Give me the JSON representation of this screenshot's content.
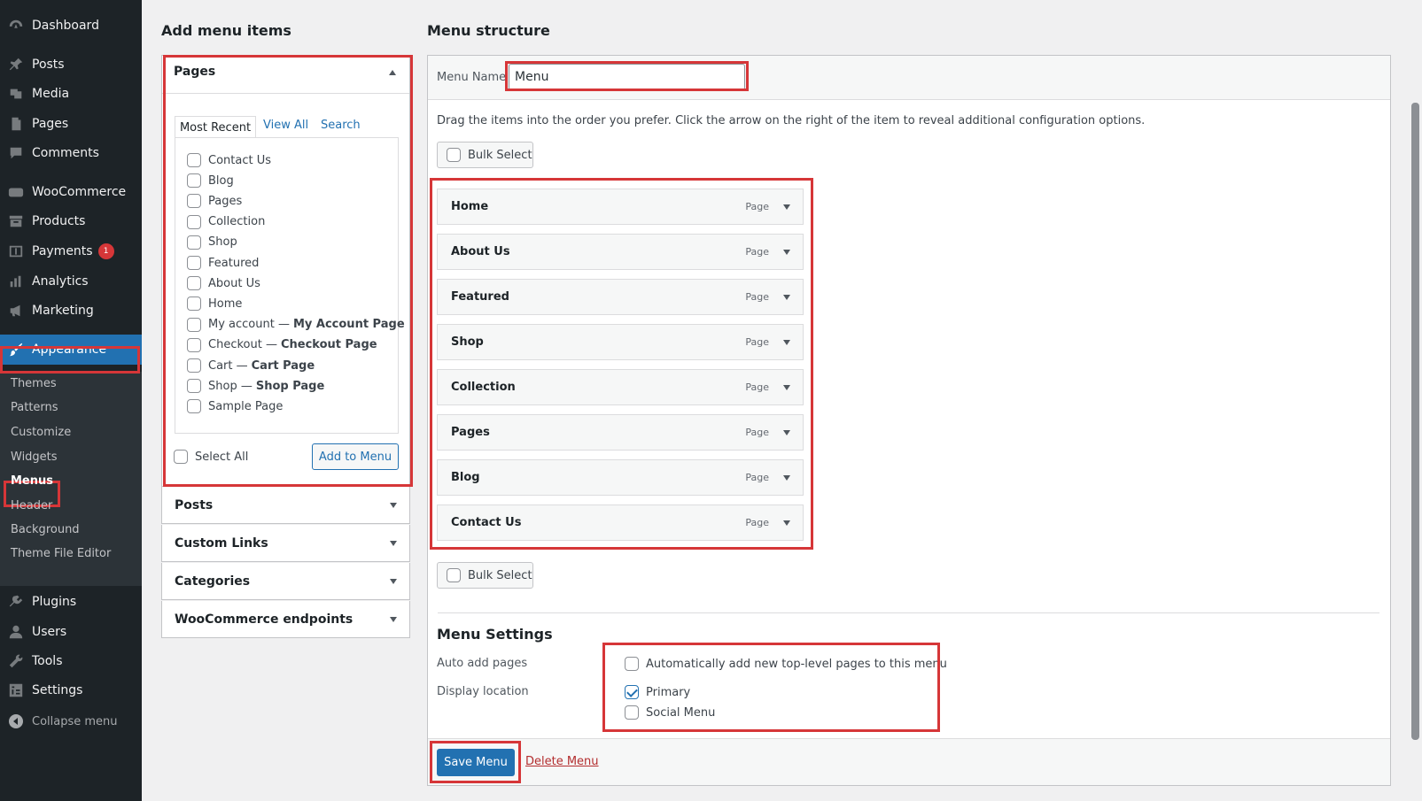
{
  "sidebar": {
    "top_items": [
      {
        "label": "Dashboard",
        "icon": "dashboard-icon"
      },
      {
        "label": "Posts",
        "icon": "pin-icon"
      },
      {
        "label": "Media",
        "icon": "media-icon"
      },
      {
        "label": "Pages",
        "icon": "pages-icon"
      },
      {
        "label": "Comments",
        "icon": "comment-icon"
      },
      {
        "label": "WooCommerce",
        "icon": "woo-icon"
      },
      {
        "label": "Products",
        "icon": "archive-icon"
      },
      {
        "label": "Payments",
        "icon": "payment-icon",
        "badge": "1"
      },
      {
        "label": "Analytics",
        "icon": "bar-chart-icon"
      },
      {
        "label": "Marketing",
        "icon": "megaphone-icon"
      },
      {
        "label": "Appearance",
        "icon": "brush-icon"
      }
    ],
    "submenu": [
      "Themes",
      "Patterns",
      "Customize",
      "Widgets",
      "Menus",
      "Header",
      "Background",
      "Theme File Editor"
    ],
    "bottom_items": [
      {
        "label": "Plugins",
        "icon": "plugin-icon"
      },
      {
        "label": "Users",
        "icon": "user-icon"
      },
      {
        "label": "Tools",
        "icon": "wrench-icon"
      },
      {
        "label": "Settings",
        "icon": "settings-icon"
      }
    ],
    "collapse_label": "Collapse menu"
  },
  "add_items": {
    "heading": "Add menu items",
    "pages_title": "Pages",
    "tabs": [
      "Most Recent",
      "View All",
      "Search"
    ],
    "pages": [
      {
        "label": "Contact Us"
      },
      {
        "label": "Blog"
      },
      {
        "label": "Pages"
      },
      {
        "label": "Collection"
      },
      {
        "label": "Shop"
      },
      {
        "label": "Featured"
      },
      {
        "label": "About Us"
      },
      {
        "label": "Home"
      },
      {
        "label": "My account —",
        "strong": "My Account Page"
      },
      {
        "label": "Checkout —",
        "strong": "Checkout Page"
      },
      {
        "label": "Cart —",
        "strong": "Cart Page"
      },
      {
        "label": "Shop —",
        "strong": "Shop Page"
      },
      {
        "label": "Sample Page"
      }
    ],
    "select_all": "Select All",
    "add_button": "Add to Menu",
    "other_sections": [
      "Posts",
      "Custom Links",
      "Categories",
      "WooCommerce endpoints"
    ]
  },
  "structure": {
    "heading": "Menu structure",
    "menu_name_label": "Menu Name",
    "menu_name_value": "Menu",
    "instructions": "Drag the items into the order you prefer. Click the arrow on the right of the item to reveal additional configuration options.",
    "bulk_select": "Bulk Select",
    "items": [
      {
        "title": "Home",
        "type": "Page"
      },
      {
        "title": "About Us",
        "type": "Page"
      },
      {
        "title": "Featured",
        "type": "Page"
      },
      {
        "title": "Shop",
        "type": "Page"
      },
      {
        "title": "Collection",
        "type": "Page"
      },
      {
        "title": "Pages",
        "type": "Page"
      },
      {
        "title": "Blog",
        "type": "Page"
      },
      {
        "title": "Contact Us",
        "type": "Page"
      }
    ],
    "settings_heading": "Menu Settings",
    "auto_add_label": "Auto add pages",
    "auto_add_option": "Automatically add new top-level pages to this menu",
    "display_location_label": "Display location",
    "locations": [
      {
        "label": "Primary",
        "checked": true
      },
      {
        "label": "Social Menu",
        "checked": false
      }
    ],
    "save_button": "Save Menu",
    "delete_link": "Delete Menu"
  }
}
